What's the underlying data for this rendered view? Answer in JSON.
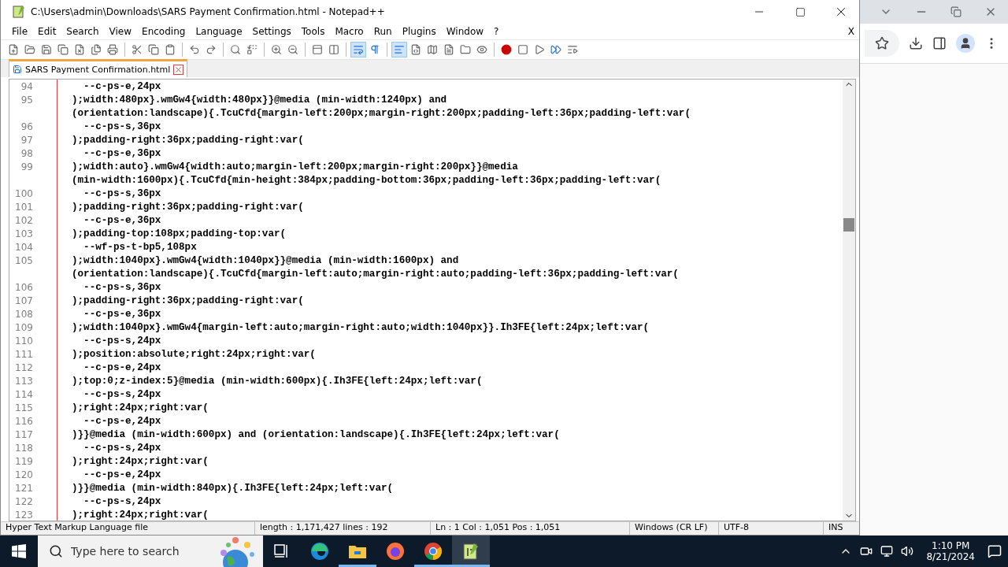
{
  "window": {
    "title": "C:\\Users\\admin\\Downloads\\SARS Payment Confirmation.html - Notepad++",
    "close_document": "X"
  },
  "menu": [
    "File",
    "Edit",
    "Search",
    "View",
    "Encoding",
    "Language",
    "Settings",
    "Tools",
    "Macro",
    "Run",
    "Plugins",
    "Window",
    "?"
  ],
  "toolbar": {
    "word_wrap_on": true,
    "show_all_characters_on": false,
    "indent_guide_on": true
  },
  "tabs": [
    {
      "label": "SARS Payment Confirmation.html",
      "selected": true
    }
  ],
  "lines": [
    {
      "number": "94",
      "text": "  --c-ps-e,24px"
    },
    {
      "number": "95",
      "text": ");width:480px}.wmGw4{width:480px}}@media (min-width:1240px) and"
    },
    {
      "text": "(orientation:landscape){.TcuCfd{margin-left:200px;margin-right:200px;padding-left:36px;padding-left:var("
    },
    {
      "number": "96",
      "text": "  --c-ps-s,36px"
    },
    {
      "number": "97",
      "text": ");padding-right:36px;padding-right:var("
    },
    {
      "number": "98",
      "text": "  --c-ps-e,36px"
    },
    {
      "number": "99",
      "text": ");width:auto}.wmGw4{width:auto;margin-left:200px;margin-right:200px}}@media"
    },
    {
      "text": "(min-width:1600px){.TcuCfd{min-height:384px;padding-bottom:36px;padding-left:36px;padding-left:var("
    },
    {
      "number": "100",
      "text": "  --c-ps-s,36px"
    },
    {
      "number": "101",
      "text": ");padding-right:36px;padding-right:var("
    },
    {
      "number": "102",
      "text": "  --c-ps-e,36px"
    },
    {
      "number": "103",
      "text": ");padding-top:108px;padding-top:var("
    },
    {
      "number": "104",
      "text": "  --wf-ps-t-bp5,108px"
    },
    {
      "number": "105",
      "text": ");width:1040px}.wmGw4{width:1040px}}@media (min-width:1600px) and"
    },
    {
      "text": "(orientation:landscape){.TcuCfd{margin-left:auto;margin-right:auto;padding-left:36px;padding-left:var("
    },
    {
      "number": "106",
      "text": "  --c-ps-s,36px"
    },
    {
      "number": "107",
      "text": ");padding-right:36px;padding-right:var("
    },
    {
      "number": "108",
      "text": "  --c-ps-e,36px"
    },
    {
      "number": "109",
      "text": ");width:1040px}.wmGw4{margin-left:auto;margin-right:auto;width:1040px}}.Ih3FE{left:24px;left:var("
    },
    {
      "number": "110",
      "text": "  --c-ps-s,24px"
    },
    {
      "number": "111",
      "text": ");position:absolute;right:24px;right:var("
    },
    {
      "number": "112",
      "text": "  --c-ps-e,24px"
    },
    {
      "number": "113",
      "text": ");top:0;z-index:5}@media (min-width:600px){.Ih3FE{left:24px;left:var("
    },
    {
      "number": "114",
      "text": "  --c-ps-s,24px"
    },
    {
      "number": "115",
      "text": ");right:24px;right:var("
    },
    {
      "number": "116",
      "text": "  --c-ps-e,24px"
    },
    {
      "number": "117",
      "text": ")}}@media (min-width:600px) and (orientation:landscape){.Ih3FE{left:24px;left:var("
    },
    {
      "number": "118",
      "text": "  --c-ps-s,24px"
    },
    {
      "number": "119",
      "text": ");right:24px;right:var("
    },
    {
      "number": "120",
      "text": "  --c-ps-e,24px"
    },
    {
      "number": "121",
      "text": ")}}@media (min-width:840px){.Ih3FE{left:24px;left:var("
    },
    {
      "number": "122",
      "text": "  --c-ps-s,24px"
    },
    {
      "number": "123",
      "text": ");right:24px;right:var("
    }
  ],
  "status_bar": [
    "Hyper Text Markup Language file",
    "length : 1,171,427    lines : 192",
    "Ln : 1    Col : 1,051    Pos : 1,051",
    "Windows (CR LF)",
    "UTF-8",
    "INS"
  ],
  "taskbar": {
    "search": {
      "placeholder": "Type here to search"
    },
    "apps": [
      {
        "kind": "taskview",
        "running": false,
        "selected": false
      },
      {
        "kind": "edge",
        "running": false,
        "selected": false
      },
      {
        "kind": "explorer",
        "running": true,
        "selected": false
      },
      {
        "kind": "firefox",
        "running": false,
        "selected": false
      },
      {
        "kind": "chrome",
        "running": true,
        "selected": false
      },
      {
        "kind": "notepad",
        "running": true,
        "selected": true
      }
    ],
    "time": "1:10 PM",
    "date": "8/21/2024"
  }
}
